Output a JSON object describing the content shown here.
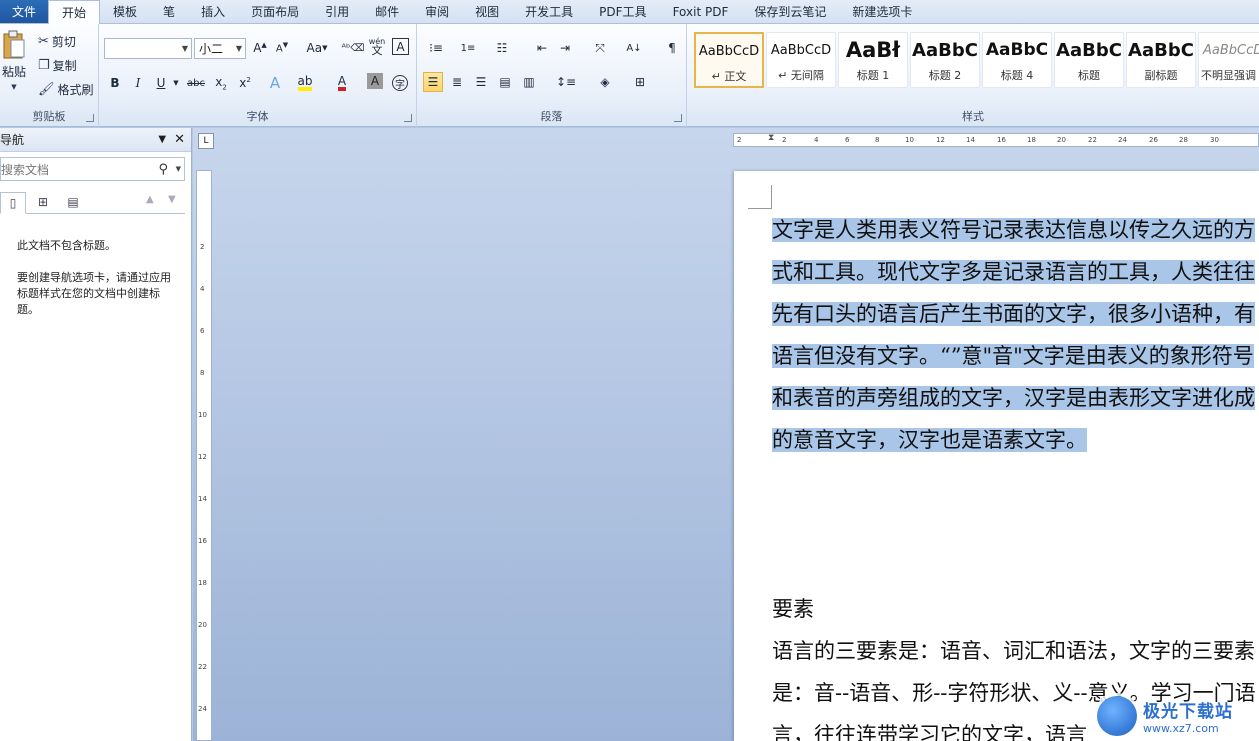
{
  "tabs": [
    "文件",
    "开始",
    "模板",
    "笔",
    "插入",
    "页面布局",
    "引用",
    "邮件",
    "审阅",
    "视图",
    "开发工具",
    "PDF工具",
    "Foxit PDF",
    "保存到云笔记",
    "新建选项卡"
  ],
  "clipboard": {
    "paste": "粘贴",
    "cut": "剪切",
    "copy": "复制",
    "format_painter": "格式刷",
    "label": "剪贴板"
  },
  "font": {
    "name_value": "",
    "size_value": "小二",
    "label": "字体",
    "aa": "Aa",
    "wen": "wén",
    "wen_sub": "文",
    "A_box": "A"
  },
  "paragraph": {
    "label": "段落"
  },
  "styles": {
    "label": "样式",
    "items": [
      {
        "sample": "AaBbCcD",
        "name": "↵ 正文"
      },
      {
        "sample": "AaBbCcD",
        "name": "↵ 无间隔"
      },
      {
        "sample": "AaBł",
        "name": "标题 1"
      },
      {
        "sample": "AaBbC",
        "name": "标题 2"
      },
      {
        "sample": "AaBbC",
        "name": "标题 4"
      },
      {
        "sample": "AaBbC",
        "name": "标题"
      },
      {
        "sample": "AaBbC",
        "name": "副标题"
      },
      {
        "sample": "AaBbCcD",
        "name": "不明显强调"
      }
    ]
  },
  "nav": {
    "title": "导航",
    "search_placeholder": "搜索文档",
    "msg1": "此文档不包含标题。",
    "msg2": "要创建导航选项卡，请通过应用标题样式在您的文档中创建标题。"
  },
  "ruler": {
    "h_ticks": [
      "2",
      "2",
      "4",
      "6",
      "8",
      "10",
      "12",
      "14",
      "16",
      "18",
      "20",
      "22",
      "24",
      "26",
      "28",
      "30"
    ],
    "v_ticks": [
      "2",
      "4",
      "6",
      "8",
      "10",
      "12",
      "14",
      "16",
      "18",
      "20",
      "22",
      "24"
    ],
    "corner": "L"
  },
  "document": {
    "para1": "文字是人类用表义符号记录表达信息以传之久远的方式和工具。现代文字多是记录语言的工具，人类往往先有口头的语言后产生书面的文字，很多小语种，有语言但没有文字。“”意\"音\"文字是由表义的象形符号和表音的声旁组成的文字，汉字是由表形文字进化成的意音文字，汉字也是语素文字。",
    "heading": "要素",
    "para2": "语言的三要素是：语音、词汇和语法，文字的三要素是：音--语音、形--字符形状、义--意义。学习一门语言，往往连带学习它的文字，语言"
  },
  "watermark": {
    "t1": "极光下载站",
    "t2": "www.xz7.com"
  }
}
